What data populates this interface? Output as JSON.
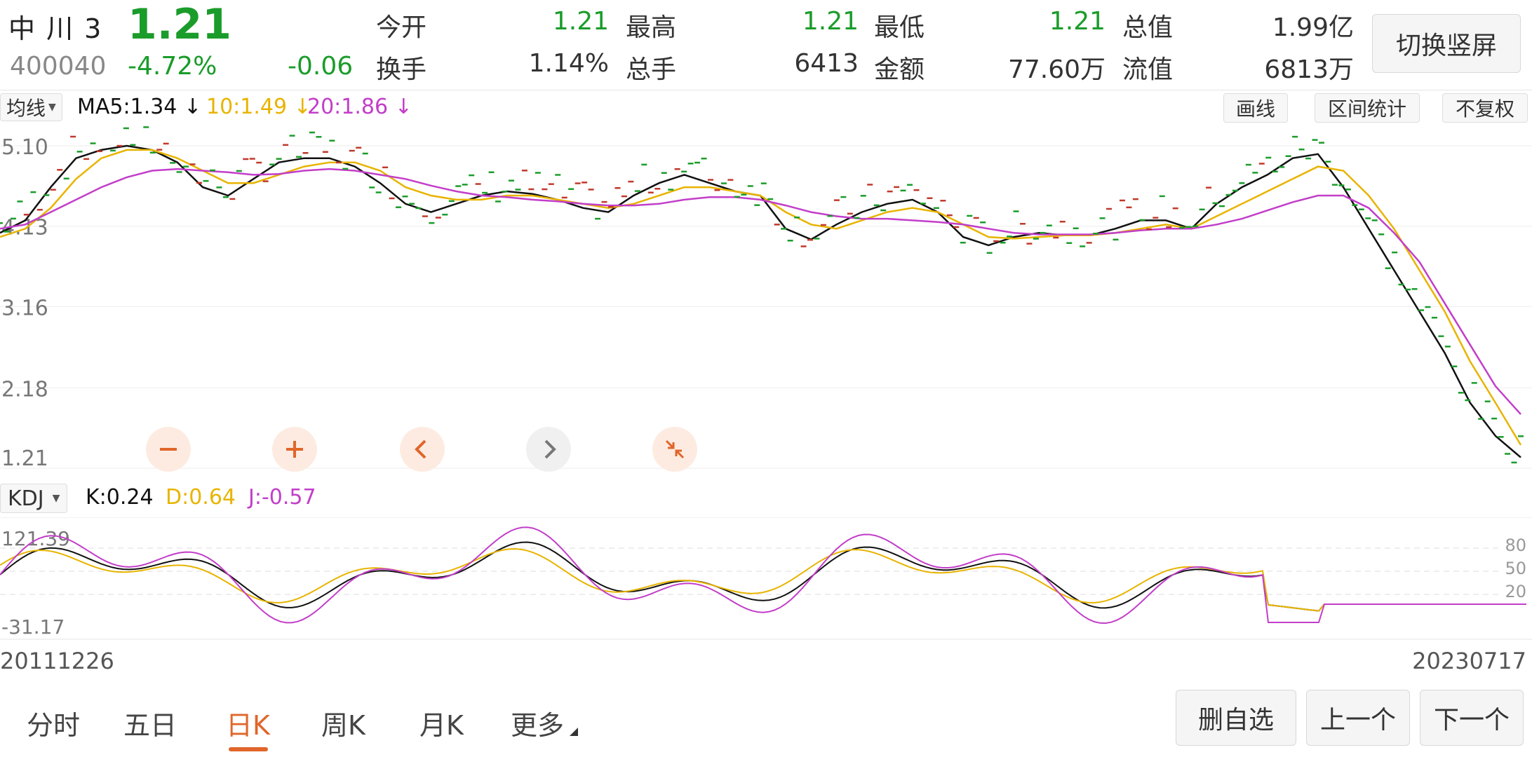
{
  "stock": {
    "name": "中 川 3",
    "price": "1.21",
    "code": "400040",
    "change_pct": "-4.72%",
    "change": "-0.06"
  },
  "quote": {
    "row1": [
      {
        "label": "今开",
        "value": "1.21",
        "color": "green"
      },
      {
        "label": "最高",
        "value": "1.21",
        "color": "green"
      },
      {
        "label": "最低",
        "value": "1.21",
        "color": "green"
      },
      {
        "label": "总值",
        "value": "1.99亿",
        "color": "black"
      }
    ],
    "row2": [
      {
        "label": "换手",
        "value": "1.14%",
        "color": "black"
      },
      {
        "label": "总手",
        "value": "6413",
        "color": "black"
      },
      {
        "label": "金额",
        "value": "77.60万",
        "color": "black"
      },
      {
        "label": "流值",
        "value": "6813万",
        "color": "black"
      }
    ]
  },
  "toolbar": {
    "switch_label": "切换竖屏",
    "ma_select": "均线",
    "ma5": "MA5:1.34",
    "ma10": "10:1.49",
    "ma20": "20:1.86",
    "arrow": "↓",
    "draw_line": "画线",
    "range_stats": "区间统计",
    "no_adjust": "不复权"
  },
  "kdj": {
    "select": "KDJ",
    "k": "K:0.24",
    "d": "D:0.64",
    "j": "J:-0.57",
    "y_max": "121.39",
    "y_min": "-31.17",
    "levels": [
      "80",
      "50",
      "20"
    ]
  },
  "dates": {
    "start": "20111226",
    "end": "20230717"
  },
  "tabs": [
    {
      "label": "分时",
      "active": false
    },
    {
      "label": "五日",
      "active": false
    },
    {
      "label": "日K",
      "active": true
    },
    {
      "label": "周K",
      "active": false
    },
    {
      "label": "月K",
      "active": false
    },
    {
      "label": "更多",
      "active": false
    }
  ],
  "actions": {
    "remove_watch": "删自选",
    "prev": "上一个",
    "next": "下一个"
  },
  "colors": {
    "green": "#1a9c2a",
    "red": "#c0392b",
    "ma5": "#111111",
    "ma10": "#e8b400",
    "ma20": "#c23ec9",
    "accent": "#e0662a"
  },
  "chart_data": {
    "type": "line",
    "y_ticks": [
      "5.10",
      "4.13",
      "3.16",
      "2.18",
      "1.21"
    ],
    "ylim": [
      1.21,
      5.1
    ],
    "series": [
      {
        "name": "MA5",
        "values": [
          4.05,
          4.2,
          4.6,
          4.95,
          5.05,
          5.1,
          5.05,
          4.9,
          4.6,
          4.5,
          4.7,
          4.9,
          4.95,
          4.95,
          4.85,
          4.65,
          4.4,
          4.3,
          4.4,
          4.5,
          4.55,
          4.52,
          4.45,
          4.35,
          4.3,
          4.5,
          4.65,
          4.75,
          4.65,
          4.55,
          4.5,
          4.1,
          3.97,
          4.15,
          4.3,
          4.4,
          4.45,
          4.3,
          4.0,
          3.9,
          4.0,
          4.05,
          4.02,
          4.02,
          4.1,
          4.2,
          4.2,
          4.1,
          4.4,
          4.6,
          4.75,
          4.95,
          5.0,
          4.6,
          4.1,
          3.6,
          3.1,
          2.6,
          2.0,
          1.6,
          1.34
        ]
      },
      {
        "name": "10",
        "values": [
          4.0,
          4.1,
          4.35,
          4.7,
          4.95,
          5.05,
          5.05,
          4.95,
          4.8,
          4.65,
          4.65,
          4.75,
          4.85,
          4.9,
          4.9,
          4.8,
          4.6,
          4.5,
          4.45,
          4.45,
          4.5,
          4.5,
          4.45,
          4.4,
          4.35,
          4.4,
          4.5,
          4.6,
          4.6,
          4.55,
          4.5,
          4.3,
          4.15,
          4.1,
          4.2,
          4.3,
          4.35,
          4.3,
          4.15,
          4.0,
          3.98,
          4.0,
          4.02,
          4.02,
          4.05,
          4.1,
          4.15,
          4.1,
          4.25,
          4.4,
          4.55,
          4.7,
          4.85,
          4.8,
          4.5,
          4.1,
          3.6,
          3.1,
          2.5,
          2.0,
          1.49
        ]
      },
      {
        "name": "20",
        "values": [
          4.1,
          4.15,
          4.3,
          4.45,
          4.6,
          4.72,
          4.8,
          4.82,
          4.8,
          4.78,
          4.75,
          4.76,
          4.8,
          4.82,
          4.8,
          4.75,
          4.7,
          4.62,
          4.55,
          4.5,
          4.48,
          4.45,
          4.43,
          4.4,
          4.38,
          4.38,
          4.4,
          4.45,
          4.48,
          4.48,
          4.45,
          4.38,
          4.3,
          4.25,
          4.22,
          4.22,
          4.2,
          4.18,
          4.15,
          4.1,
          4.05,
          4.03,
          4.03,
          4.03,
          4.05,
          4.08,
          4.1,
          4.1,
          4.15,
          4.22,
          4.32,
          4.42,
          4.5,
          4.5,
          4.35,
          4.05,
          3.7,
          3.2,
          2.7,
          2.2,
          1.86
        ]
      }
    ]
  }
}
